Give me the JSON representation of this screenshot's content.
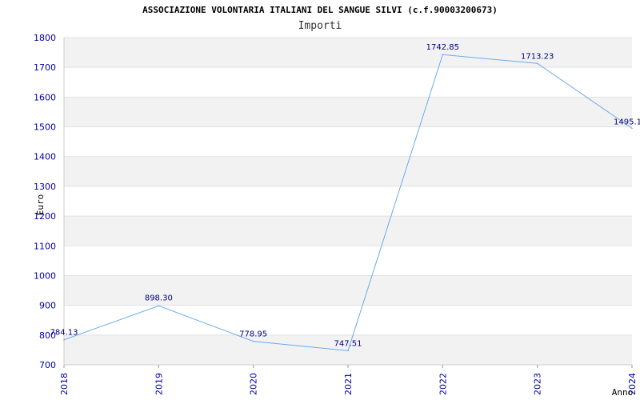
{
  "chart_data": {
    "type": "line",
    "title": "ASSOCIAZIONE VOLONTARIA ITALIANI DEL SANGUE SILVI (c.f.90003200673)",
    "subtitle": "Importi",
    "xlabel": "Anno",
    "ylabel": "Euro",
    "x": [
      "2018",
      "2019",
      "2020",
      "2021",
      "2022",
      "2023",
      "2024"
    ],
    "series": [
      {
        "values": [
          784.13,
          898.3,
          778.95,
          747.51,
          1742.85,
          1713.23,
          1495.1
        ],
        "labels": [
          "784.13",
          "898.30",
          "778.95",
          "747.51",
          "1742.85",
          "1713.23",
          "1495.1"
        ]
      }
    ],
    "ylim": [
      700,
      1800
    ],
    "yticks": [
      700,
      800,
      900,
      1000,
      1100,
      1200,
      1300,
      1400,
      1500,
      1600,
      1700,
      1800
    ],
    "grid": true,
    "band_colors": [
      "#f2f2f2",
      "#ffffff"
    ],
    "line_color": "#6aaaee",
    "tick_color": "#0000aa",
    "label_color": "#000080"
  }
}
